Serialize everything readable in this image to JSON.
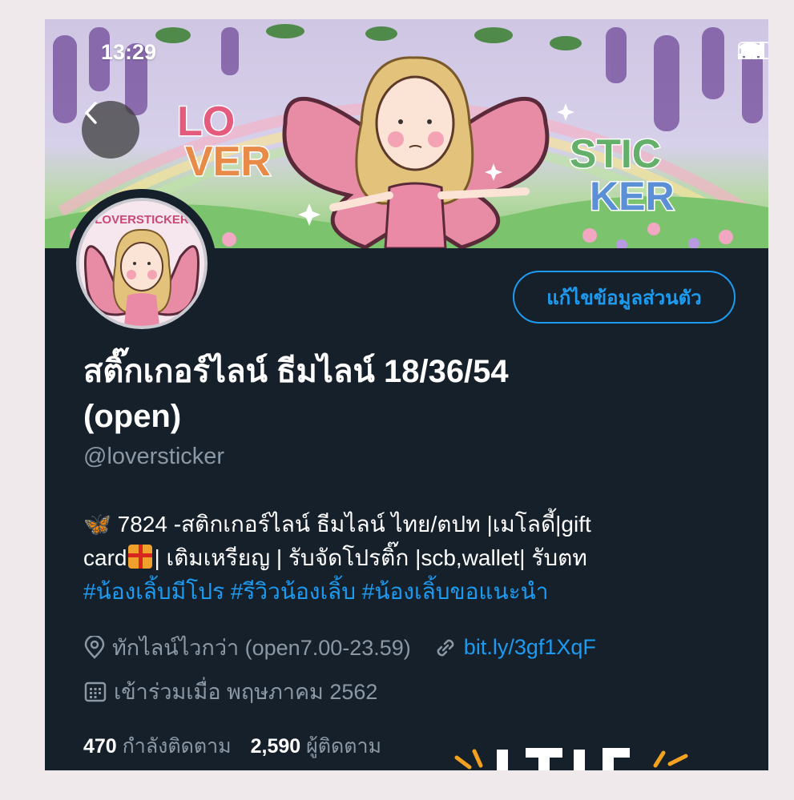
{
  "status_bar": {
    "time": "13:29"
  },
  "banner": {
    "text_left_1": "LO",
    "text_left_2": "VER",
    "text_right_1": "STIC",
    "text_right_2": "KER"
  },
  "avatar": {
    "badge_text": "LOVERSTICKER"
  },
  "profile": {
    "edit_button": "แก้ไขข้อมูลส่วนตัว",
    "display_name_line1": "สติ๊กเกอร์ไลน์ ธีมไลน์ 18/36/54",
    "display_name_line2": "(open)",
    "handle": "@loversticker"
  },
  "bio": {
    "emoji": "🦋",
    "line1_text": "7824 -สติกเกอร์ไลน์ ธีมไลน์ ไทย/ตปท |เมโลดี้|gift",
    "line2_part1": "card",
    "line2_part2": "| เติมเหรียญ | รับจัดโปรติ๊ก |scb,wallet| รับตท",
    "hashtags": "#น้องเลิ้บมีโปร #รีวิวน้องเลิ้บ #น้องเลิ้บขอแนะนำ"
  },
  "meta": {
    "location": "ทักไลน์ไวกว่า (open7.00-23.59)",
    "link": "bit.ly/3gf1XqF",
    "joined": "เข้าร่วมเมื่อ พฤษภาคม 2562"
  },
  "counts": {
    "following_count": "470",
    "following_label": "กำลังติดตาม",
    "followers_count": "2,590",
    "followers_label": "ผู้ติดตาม"
  },
  "colors": {
    "background": "#15202b",
    "accent": "#1d9bf0",
    "secondary_text": "#8b98a5"
  }
}
